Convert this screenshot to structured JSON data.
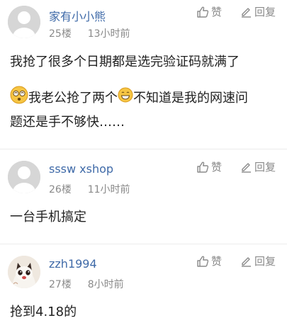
{
  "posts": [
    {
      "username": "家有小小熊",
      "floor": "25楼",
      "time": "13小时前",
      "like_label": "赞",
      "reply_label": "回复",
      "content": [
        "我抢了很多个日期都是选完验证码就满了",
        {
          "emoji": "dizzy-face-emoji",
          "text": "我老公抢了两个"
        },
        {
          "emoji": "grinning-face-emoji",
          "text": "不知道是我的网速问"
        },
        "题还是手不够快……"
      ]
    },
    {
      "username": "sssw xshop",
      "floor": "26楼",
      "time": "11小时前",
      "like_label": "赞",
      "reply_label": "回复",
      "content": [
        "一台手机搞定"
      ]
    },
    {
      "username": "zzh1994",
      "floor": "27楼",
      "time": "8小时前",
      "like_label": "赞",
      "reply_label": "回复",
      "content": [
        "抢到4.18的"
      ]
    }
  ],
  "colors": {
    "username": "#3f6aa8",
    "meta": "#8a8a8a",
    "divider": "#ececec"
  }
}
